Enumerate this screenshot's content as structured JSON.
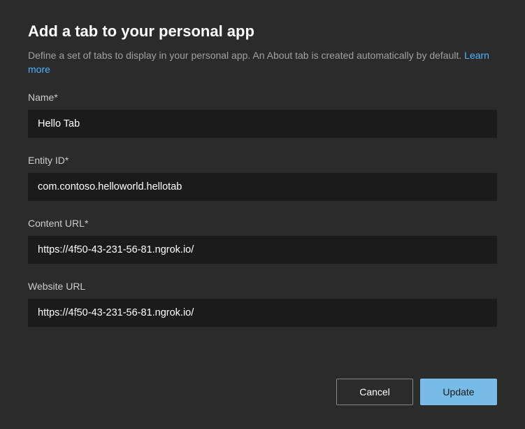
{
  "dialog": {
    "title": "Add a tab to your personal app",
    "description": "Define a set of tabs to display in your personal app. An About tab is created automatically by default.",
    "learn_more_label": "Learn more"
  },
  "fields": {
    "name": {
      "label": "Name",
      "required_mark": "*",
      "value": "Hello Tab"
    },
    "entity_id": {
      "label": "Entity ID",
      "required_mark": "*",
      "value": "com.contoso.helloworld.hellotab"
    },
    "content_url": {
      "label": "Content URL",
      "required_mark": "*",
      "value": "https://4f50-43-231-56-81.ngrok.io/"
    },
    "website_url": {
      "label": "Website URL",
      "required_mark": "",
      "value": "https://4f50-43-231-56-81.ngrok.io/"
    }
  },
  "buttons": {
    "cancel": "Cancel",
    "update": "Update"
  }
}
